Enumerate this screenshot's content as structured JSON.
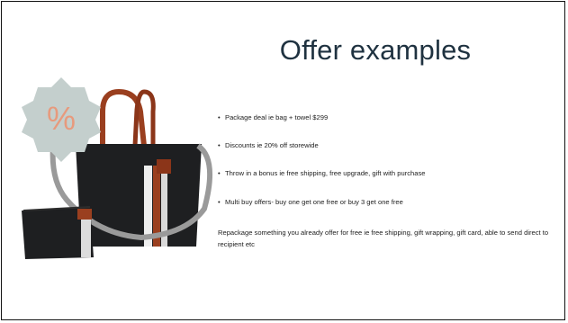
{
  "slide": {
    "title": "Offer examples",
    "badge_text": "%",
    "bullets": [
      "Package deal ie bag + towel $299",
      "Discounts ie 20% off storewide",
      "Throw in a bonus ie free shipping, free upgrade, gift with purchase",
      "Multi buy offers- buy one get one free or buy 3 get one free"
    ],
    "paragraph": "Repackage something you already offer for free ie free shipping, gift wrapping, gift card, able to send direct to recipient etc"
  },
  "colors": {
    "title": "#1f3240",
    "badge": "#c4cfcd",
    "bag": "#1e1f21",
    "leather": "#9a3f1f"
  },
  "icons": [
    "percent-badge-icon",
    "tote-bag-image",
    "pouch-image"
  ]
}
